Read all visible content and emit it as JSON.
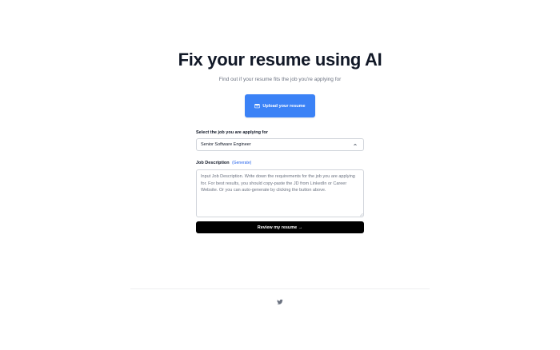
{
  "hero": {
    "title": "Fix your resume using AI",
    "subtitle": "Find out if your resume fits the job you're applying for"
  },
  "upload": {
    "label": "Upload your resume",
    "icon": "upload-icon",
    "color": "#3b82f6"
  },
  "job_select": {
    "label": "Select the job you are applying for",
    "selected": "Senior Software Engineer",
    "icon": "chevron-up-icon"
  },
  "job_description": {
    "label": "Job Description",
    "generate_link": "(Generate)",
    "placeholder": "Input Job Description. Write down the requirements for the job you are applying for. For best results, you should copy-paste the JD from LinkedIn or Career Website. Or you can auto-generate by clicking the button above."
  },
  "review": {
    "label": "Review my resume →",
    "color": "#000000"
  },
  "footer": {
    "icon": "twitter-icon"
  }
}
